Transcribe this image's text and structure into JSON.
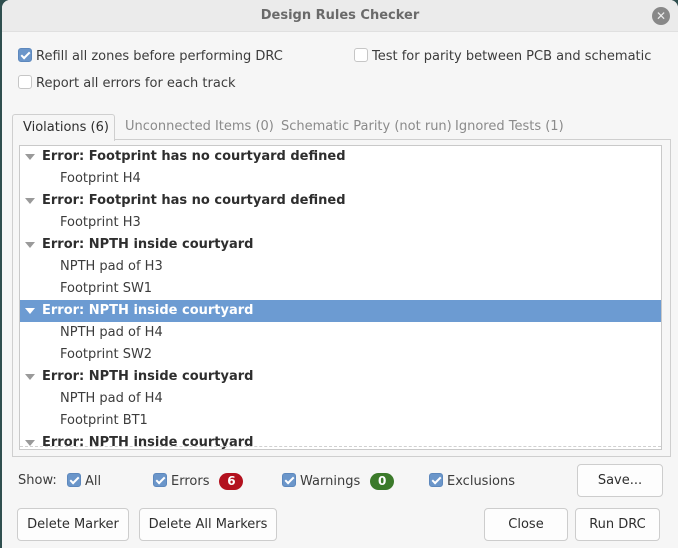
{
  "window": {
    "title": "Design Rules Checker",
    "close_icon": "close-circle-icon"
  },
  "options": {
    "refill_zones": {
      "label": "Refill all zones before performing DRC",
      "checked": true
    },
    "test_parity": {
      "label": "Test for parity between PCB and schematic",
      "checked": false
    },
    "report_all_errors": {
      "label": "Report all errors for each track",
      "checked": false
    }
  },
  "tabs": [
    {
      "label": "Violations (6)",
      "active": true
    },
    {
      "label": "Unconnected Items (0)",
      "active": false
    },
    {
      "label": "Schematic Parity (not run)",
      "active": false
    },
    {
      "label": "Ignored Tests (1)",
      "active": false
    }
  ],
  "violations": [
    {
      "title": "Error: Footprint has no courtyard defined",
      "items": [
        "Footprint H4"
      ],
      "selected": false
    },
    {
      "title": "Error: Footprint has no courtyard defined",
      "items": [
        "Footprint H3"
      ],
      "selected": false
    },
    {
      "title": "Error: NPTH inside courtyard",
      "items": [
        "NPTH pad of H3",
        "Footprint SW1"
      ],
      "selected": false
    },
    {
      "title": "Error: NPTH inside courtyard",
      "items": [
        "NPTH pad of H4",
        "Footprint SW2"
      ],
      "selected": true
    },
    {
      "title": "Error: NPTH inside courtyard",
      "items": [
        "NPTH pad of H4",
        "Footprint BT1"
      ],
      "selected": false
    },
    {
      "title": "Error: NPTH inside courtyard",
      "items": [],
      "selected": false
    }
  ],
  "filters": {
    "show_label": "Show:",
    "all": {
      "label": "All",
      "checked": true
    },
    "errors": {
      "label": "Errors",
      "checked": true,
      "count": "6",
      "badge_color": "#b3111e"
    },
    "warnings": {
      "label": "Warnings",
      "checked": true,
      "count": "0",
      "badge_color": "#3b7a2a"
    },
    "exclusions": {
      "label": "Exclusions",
      "checked": true
    }
  },
  "buttons": {
    "save": "Save...",
    "delete_marker": "Delete Marker",
    "delete_all_markers": "Delete All Markers",
    "close": "Close",
    "run_drc": "Run DRC"
  },
  "colors": {
    "selection": "#6c9bd2",
    "checkbox_accent": "#6b96ca"
  }
}
